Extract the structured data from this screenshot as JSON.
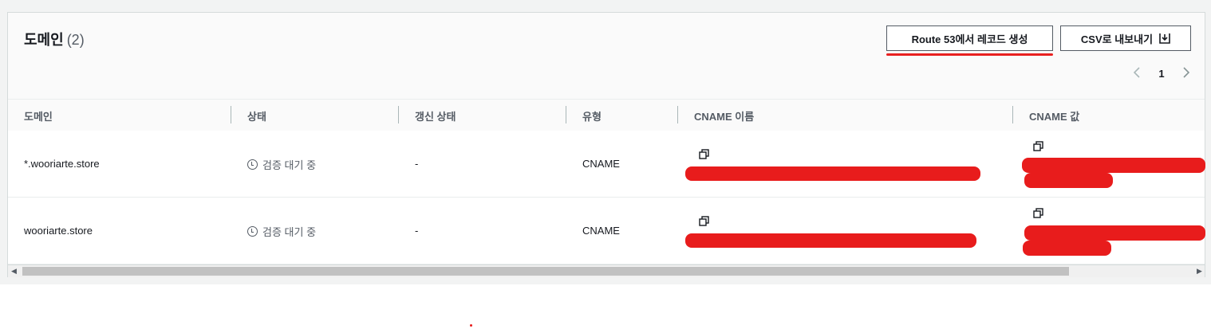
{
  "header": {
    "title": "도메인",
    "count": "(2)",
    "route53_button": "Route 53에서 레코드 생성",
    "csv_button": "CSV로 내보내기"
  },
  "pagination": {
    "current_page": "1",
    "prev_icon": "chevron-left-icon",
    "next_icon": "chevron-right-icon"
  },
  "table": {
    "columns": [
      "도메인",
      "상태",
      "갱신 상태",
      "유형",
      "CNAME 이름",
      "CNAME 값"
    ],
    "rows": [
      {
        "domain": "*.wooriarte.store",
        "status": "검증 대기 중",
        "renewal": "-",
        "type": "CNAME"
      },
      {
        "domain": "wooriarte.store",
        "status": "검증 대기 중",
        "renewal": "-",
        "type": "CNAME"
      }
    ]
  },
  "colors": {
    "redaction": "#e81c1c",
    "border": "#d5dbdb",
    "muted_text": "#545b64"
  }
}
